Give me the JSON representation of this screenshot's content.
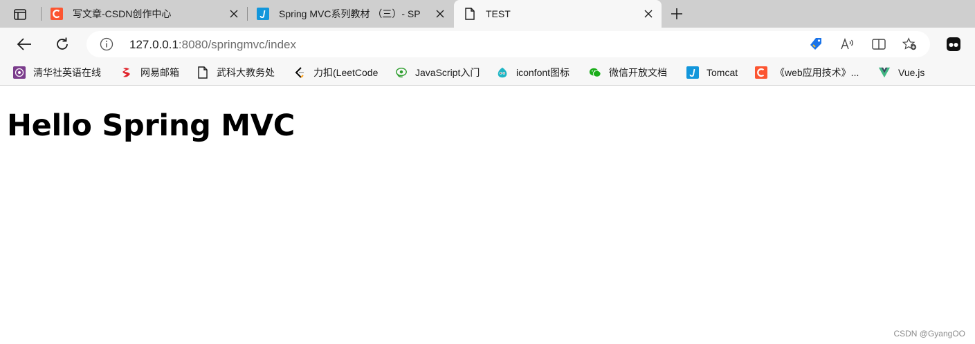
{
  "tabs": [
    {
      "title": "写文章-CSDN创作中心",
      "favicon": "csdn-icon"
    },
    {
      "title": "Spring MVC系列教材 （三）- SP",
      "favicon": "how2j-icon"
    },
    {
      "title": "TEST",
      "favicon": "page-icon",
      "active": true
    }
  ],
  "toolbar": {
    "url_host": "127.0.0.1",
    "url_rest": ":8080/springmvc/index"
  },
  "bookmarks": [
    {
      "label": "清华社英语在线",
      "icon": "tsinghua-icon"
    },
    {
      "label": "网易邮箱",
      "icon": "netease-mail-icon"
    },
    {
      "label": "武科大教务处",
      "icon": "page-icon"
    },
    {
      "label": "力扣(LeetCode",
      "icon": "leetcode-icon"
    },
    {
      "label": "JavaScript入门",
      "icon": "javascript-icon"
    },
    {
      "label": "iconfont图标",
      "icon": "iconfont-icon"
    },
    {
      "label": "微信开放文档",
      "icon": "wechat-icon"
    },
    {
      "label": "Tomcat",
      "icon": "how2j-icon"
    },
    {
      "label": "《web应用技术》...",
      "icon": "csdn-icon"
    },
    {
      "label": "Vue.js",
      "icon": "vue-icon"
    }
  ],
  "page": {
    "heading": "Hello Spring MVC",
    "watermark": "CSDN @GyangOO"
  },
  "colors": {
    "csdn": "#fc5531",
    "how2j": "#1296db",
    "tabstrip": "#cfcfcf",
    "toolbar": "#f7f7f7"
  }
}
